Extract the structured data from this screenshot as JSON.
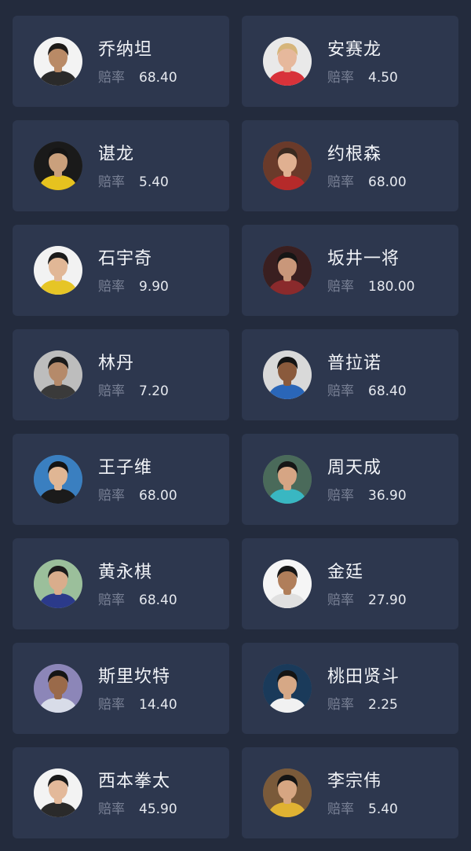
{
  "odds_label": "赔率",
  "players": [
    {
      "name": "乔纳坦",
      "odds": "68.40",
      "avatar": {
        "bg": "#f3f3f3",
        "skin": "#b98a66",
        "hair": "#1d1a18",
        "shirt": "#2a2a2a"
      }
    },
    {
      "name": "安赛龙",
      "odds": "4.50",
      "avatar": {
        "bg": "#e9e9e9",
        "skin": "#e6b89c",
        "hair": "#d6b57a",
        "shirt": "#d8323a"
      }
    },
    {
      "name": "谌龙",
      "odds": "5.40",
      "avatar": {
        "bg": "#1a1a1a",
        "skin": "#caa07c",
        "hair": "#141414",
        "shirt": "#e6c21f"
      }
    },
    {
      "name": "约根森",
      "odds": "68.00",
      "avatar": {
        "bg": "#6a3a2a",
        "skin": "#e0b091",
        "hair": "#3a2a20",
        "shirt": "#b52a2a"
      }
    },
    {
      "name": "石宇奇",
      "odds": "9.90",
      "avatar": {
        "bg": "#f2f2f2",
        "skin": "#e1b796",
        "hair": "#1b1b1b",
        "shirt": "#e6c526"
      }
    },
    {
      "name": "坂井一将",
      "odds": "180.00",
      "avatar": {
        "bg": "#3a1f20",
        "skin": "#c9977a",
        "hair": "#151515",
        "shirt": "#8a2a2c"
      }
    },
    {
      "name": "林丹",
      "odds": "7.20",
      "avatar": {
        "bg": "#bdbdbd",
        "skin": "#b58a6a",
        "hair": "#1a1a1a",
        "shirt": "#3a3a3a"
      }
    },
    {
      "name": "普拉诺",
      "odds": "68.40",
      "avatar": {
        "bg": "#d9d9d9",
        "skin": "#8a5a3c",
        "hair": "#141414",
        "shirt": "#2a66b8"
      }
    },
    {
      "name": "王子维",
      "odds": "68.00",
      "avatar": {
        "bg": "#3a7fc0",
        "skin": "#e0b694",
        "hair": "#141414",
        "shirt": "#1b1b1b"
      }
    },
    {
      "name": "周天成",
      "odds": "36.90",
      "avatar": {
        "bg": "#4a6a5a",
        "skin": "#d6a584",
        "hair": "#161616",
        "shirt": "#39b7c2"
      }
    },
    {
      "name": "黄永棋",
      "odds": "68.40",
      "avatar": {
        "bg": "#9bbf9b",
        "skin": "#d9ad8c",
        "hair": "#1c1c1c",
        "shirt": "#2b3a8a"
      }
    },
    {
      "name": "金廷",
      "odds": "27.90",
      "avatar": {
        "bg": "#f5f5f5",
        "skin": "#b07e5a",
        "hair": "#161616",
        "shirt": "#e0e0e0"
      }
    },
    {
      "name": "斯里坎特",
      "odds": "14.40",
      "avatar": {
        "bg": "#8c86b8",
        "skin": "#9a6a4a",
        "hair": "#151515",
        "shirt": "#d8dce8"
      }
    },
    {
      "name": "桃田贤斗",
      "odds": "2.25",
      "avatar": {
        "bg": "#1a3a5a",
        "skin": "#d6a886",
        "hair": "#141414",
        "shirt": "#f1f1f1"
      }
    },
    {
      "name": "西本拳太",
      "odds": "45.90",
      "avatar": {
        "bg": "#f3f3f3",
        "skin": "#e3b99a",
        "hair": "#1a1a1a",
        "shirt": "#2a2a2a"
      }
    },
    {
      "name": "李宗伟",
      "odds": "5.40",
      "avatar": {
        "bg": "#7a5a3a",
        "skin": "#d6a682",
        "hair": "#141414",
        "shirt": "#e0b232"
      }
    }
  ]
}
